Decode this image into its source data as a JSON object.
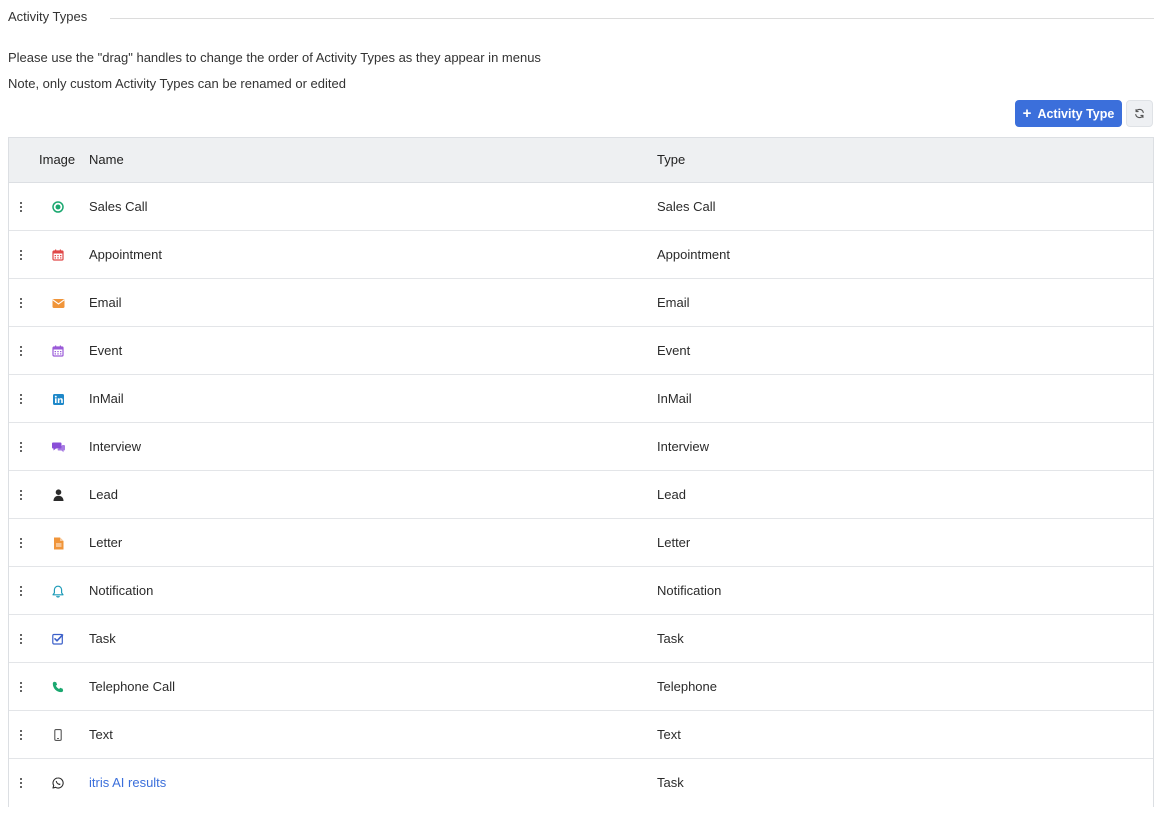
{
  "section_title": "Activity Types",
  "info": {
    "line1": "Please use the \"drag\" handles to change the order of Activity Types as they appear in menus",
    "line2": "Note, only custom Activity Types can be renamed or edited"
  },
  "toolbar": {
    "add_label": "Activity Type",
    "add_icon": "plus-icon",
    "refresh_icon": "refresh-icon",
    "accent": "#3b6fdb"
  },
  "table": {
    "columns": {
      "image": "Image",
      "name": "Name",
      "type": "Type"
    },
    "rows": [
      {
        "name": "Sales Call",
        "type": "Sales Call",
        "icon": "target-icon",
        "color": "#1ba870"
      },
      {
        "name": "Appointment",
        "type": "Appointment",
        "icon": "calendar-icon",
        "color": "#e04848"
      },
      {
        "name": "Email",
        "type": "Email",
        "icon": "envelope-icon",
        "color": "#f0953a"
      },
      {
        "name": "Event",
        "type": "Event",
        "icon": "calendar-icon",
        "color": "#9a5ad8"
      },
      {
        "name": "InMail",
        "type": "InMail",
        "icon": "linkedin-icon",
        "color": "#1e88c9"
      },
      {
        "name": "Interview",
        "type": "Interview",
        "icon": "chat-bubbles-icon",
        "color": "#8a4fd8"
      },
      {
        "name": "Lead",
        "type": "Lead",
        "icon": "person-icon",
        "color": "#2b2b2b"
      },
      {
        "name": "Letter",
        "type": "Letter",
        "icon": "document-icon",
        "color": "#f0953a"
      },
      {
        "name": "Notification",
        "type": "Notification",
        "icon": "bell-icon",
        "color": "#1e9bb8"
      },
      {
        "name": "Task",
        "type": "Task",
        "icon": "checkbox-icon",
        "color": "#3b5fc9"
      },
      {
        "name": "Telephone Call",
        "type": "Telephone",
        "icon": "phone-icon",
        "color": "#1ba870"
      },
      {
        "name": "Text",
        "type": "Text",
        "icon": "mobile-icon",
        "color": "#555555"
      },
      {
        "name": "itris AI results",
        "type": "Task",
        "icon": "whatsapp-icon",
        "color": "#2b2b2b",
        "link": true
      }
    ]
  }
}
